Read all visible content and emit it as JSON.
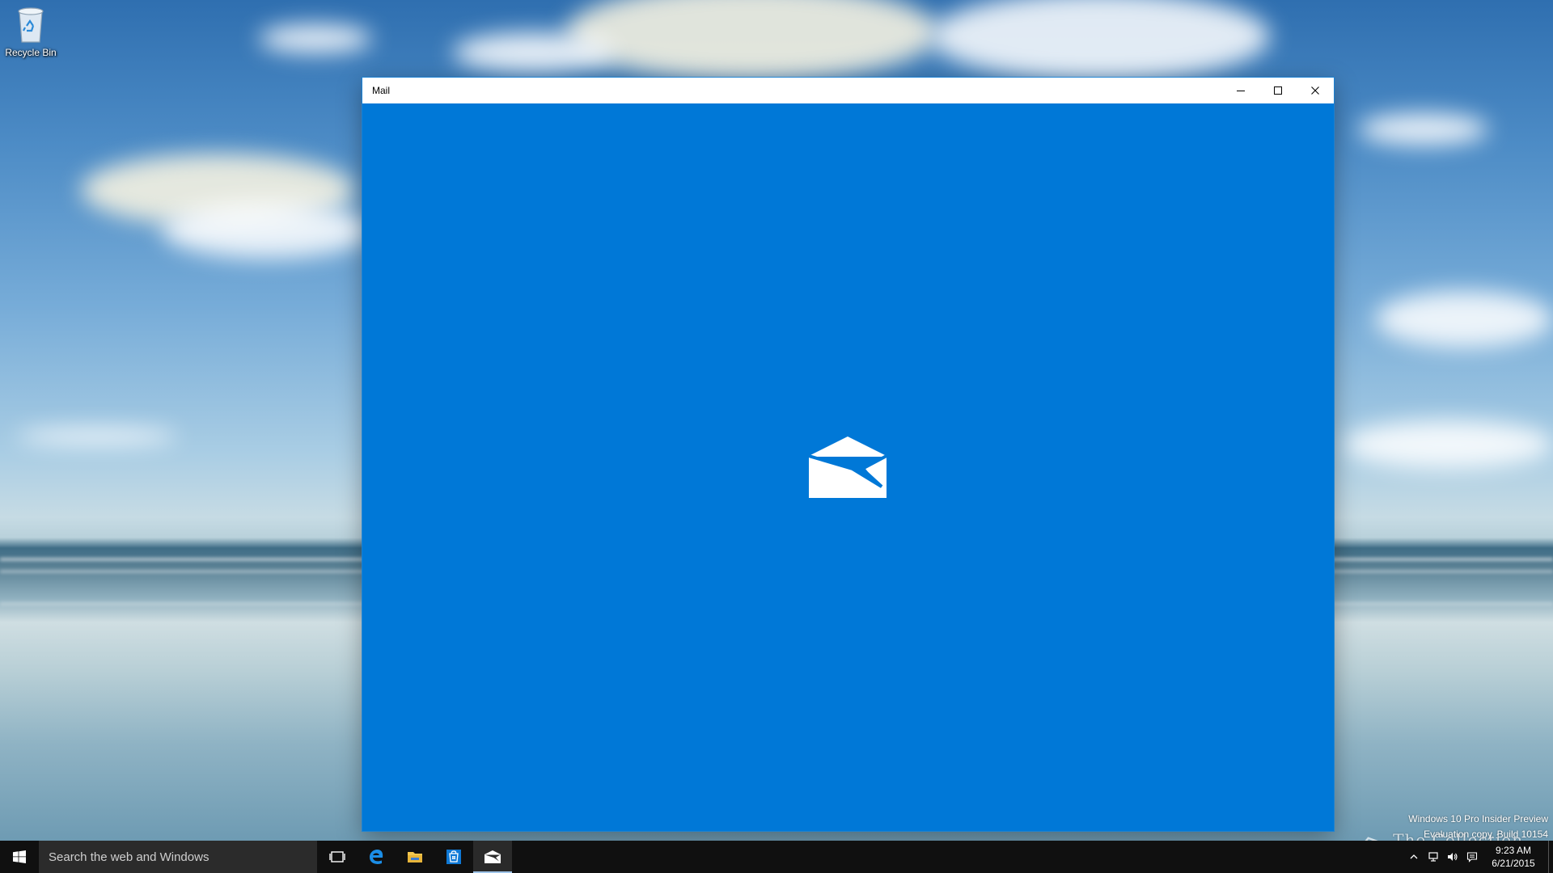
{
  "desktop": {
    "icons": [
      {
        "label": "Recycle Bin",
        "icon": "recycle-bin-icon"
      }
    ]
  },
  "window": {
    "title": "Mail",
    "controls": {
      "minimize": "minimize-icon",
      "maximize": "maximize-icon",
      "close": "close-icon"
    },
    "splash_icon": "mail-envelope-icon",
    "accent_color": "#0078d7"
  },
  "watermark": {
    "line1": "Windows 10 Pro Insider Preview",
    "line2": "Evaluation copy. Build 10154",
    "brand": "The Collection Book"
  },
  "taskbar": {
    "search_placeholder": "Search the web and Windows",
    "pinned": [
      {
        "name": "Task View",
        "icon": "task-view-icon"
      },
      {
        "name": "Microsoft Edge",
        "icon": "edge-icon"
      },
      {
        "name": "File Explorer",
        "icon": "folder-icon"
      },
      {
        "name": "Store",
        "icon": "store-icon"
      },
      {
        "name": "Mail",
        "icon": "mail-icon",
        "active": true
      }
    ],
    "tray": {
      "time": "9:23 AM",
      "date": "6/21/2015"
    }
  }
}
